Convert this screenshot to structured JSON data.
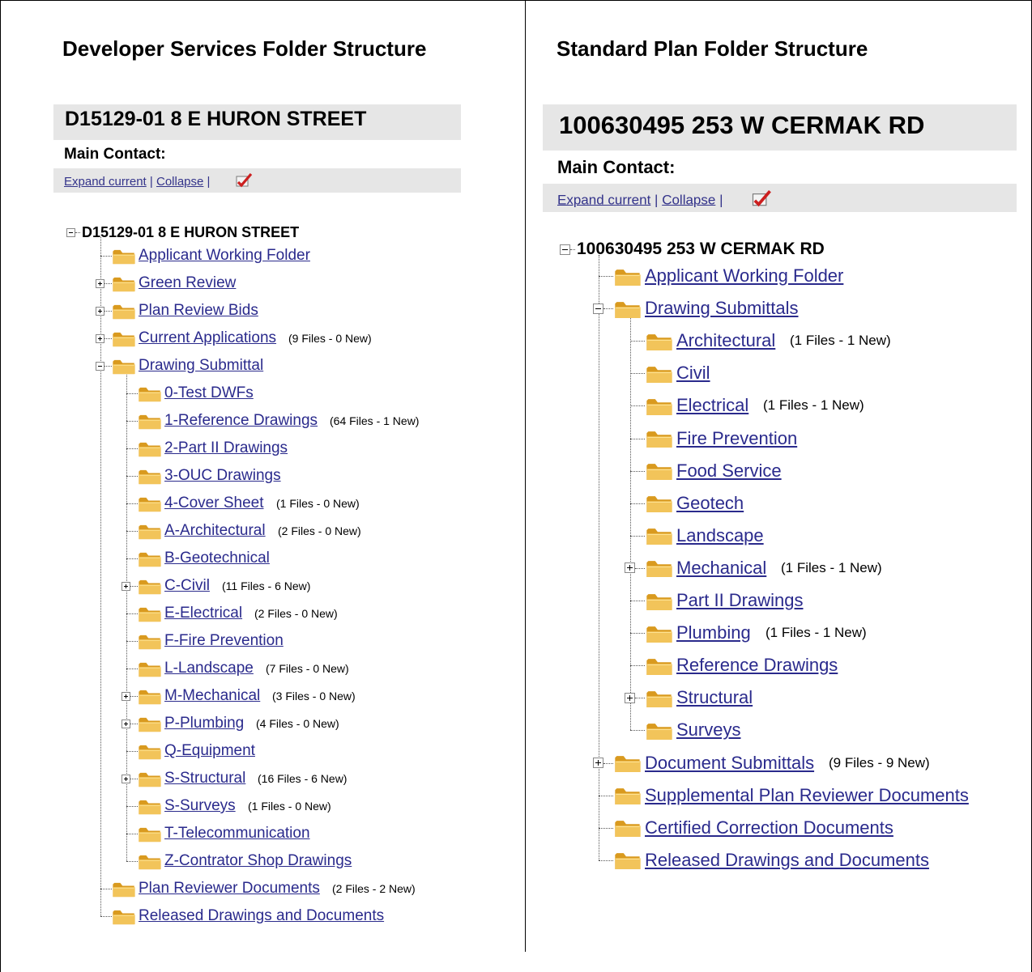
{
  "left": {
    "panel_title": "Developer Services Folder Structure",
    "project_title": "D15129-01 8 E HURON STREET",
    "main_contact": "Main Contact:",
    "toolbar": {
      "expand": "Expand current",
      "collapse": "Collapse",
      "sep": "|"
    },
    "root_label": "D15129-01 8 E HURON STREET",
    "items": [
      {
        "label": "Applicant Working Folder",
        "count": "",
        "level": 1,
        "expander": ""
      },
      {
        "label": "Green Review",
        "count": "",
        "level": 1,
        "expander": "plus"
      },
      {
        "label": "Plan Review Bids",
        "count": "",
        "level": 1,
        "expander": "plus"
      },
      {
        "label": "Current Applications",
        "count": "(9 Files - 0 New)",
        "level": 1,
        "expander": "plus"
      },
      {
        "label": "Drawing Submittal",
        "count": "",
        "level": 1,
        "expander": "minus"
      },
      {
        "label": "0-Test DWFs",
        "count": "",
        "level": 2,
        "expander": ""
      },
      {
        "label": "1-Reference Drawings",
        "count": "(64 Files - 1 New)",
        "level": 2,
        "expander": ""
      },
      {
        "label": "2-Part II Drawings",
        "count": "",
        "level": 2,
        "expander": ""
      },
      {
        "label": "3-OUC Drawings",
        "count": "",
        "level": 2,
        "expander": ""
      },
      {
        "label": "4-Cover Sheet",
        "count": "(1 Files - 0 New)",
        "level": 2,
        "expander": ""
      },
      {
        "label": "A-Architectural",
        "count": "(2 Files - 0 New)",
        "level": 2,
        "expander": ""
      },
      {
        "label": "B-Geotechnical",
        "count": "",
        "level": 2,
        "expander": ""
      },
      {
        "label": "C-Civil",
        "count": "(11 Files - 6 New)",
        "level": 2,
        "expander": "plus"
      },
      {
        "label": "E-Electrical",
        "count": "(2 Files - 0 New)",
        "level": 2,
        "expander": ""
      },
      {
        "label": "F-Fire Prevention",
        "count": "",
        "level": 2,
        "expander": ""
      },
      {
        "label": "L-Landscape",
        "count": "(7 Files - 0 New)",
        "level": 2,
        "expander": ""
      },
      {
        "label": "M-Mechanical",
        "count": "(3 Files - 0 New)",
        "level": 2,
        "expander": "plus"
      },
      {
        "label": "P-Plumbing",
        "count": "(4 Files - 0 New)",
        "level": 2,
        "expander": "plus"
      },
      {
        "label": "Q-Equipment",
        "count": "",
        "level": 2,
        "expander": ""
      },
      {
        "label": "S-Structural",
        "count": "(16 Files - 6 New)",
        "level": 2,
        "expander": "plus"
      },
      {
        "label": "S-Surveys",
        "count": "(1 Files - 0 New)",
        "level": 2,
        "expander": ""
      },
      {
        "label": "T-Telecommunication",
        "count": "",
        "level": 2,
        "expander": ""
      },
      {
        "label": "Z-Contrator Shop Drawings",
        "count": "",
        "level": 2,
        "expander": ""
      },
      {
        "label": "Plan Reviewer Documents",
        "count": "(2 Files - 2 New)",
        "level": 1,
        "expander": ""
      },
      {
        "label": "Released Drawings and Documents",
        "count": "",
        "level": 1,
        "expander": ""
      }
    ]
  },
  "right": {
    "panel_title": "Standard Plan Folder Structure",
    "project_title": "100630495 253 W CERMAK RD",
    "main_contact": "Main Contact:",
    "toolbar": {
      "expand": "Expand current",
      "collapse": "Collapse",
      "sep": "|"
    },
    "root_label": "100630495 253 W CERMAK RD",
    "items": [
      {
        "label": "Applicant Working Folder",
        "count": "",
        "level": 1,
        "expander": ""
      },
      {
        "label": "Drawing Submittals",
        "count": "",
        "level": 1,
        "expander": "minus"
      },
      {
        "label": "Architectural",
        "count": "(1 Files - 1 New)",
        "level": 2,
        "expander": ""
      },
      {
        "label": "Civil",
        "count": "",
        "level": 2,
        "expander": ""
      },
      {
        "label": "Electrical",
        "count": "(1 Files - 1 New)",
        "level": 2,
        "expander": ""
      },
      {
        "label": "Fire Prevention",
        "count": "",
        "level": 2,
        "expander": ""
      },
      {
        "label": "Food Service",
        "count": "",
        "level": 2,
        "expander": ""
      },
      {
        "label": "Geotech",
        "count": "",
        "level": 2,
        "expander": ""
      },
      {
        "label": "Landscape",
        "count": "",
        "level": 2,
        "expander": ""
      },
      {
        "label": "Mechanical",
        "count": "(1 Files - 1 New)",
        "level": 2,
        "expander": "plus"
      },
      {
        "label": "Part II Drawings",
        "count": "",
        "level": 2,
        "expander": ""
      },
      {
        "label": "Plumbing",
        "count": "(1 Files - 1 New)",
        "level": 2,
        "expander": ""
      },
      {
        "label": "Reference Drawings",
        "count": "",
        "level": 2,
        "expander": ""
      },
      {
        "label": "Structural",
        "count": "",
        "level": 2,
        "expander": "plus"
      },
      {
        "label": "Surveys",
        "count": "",
        "level": 2,
        "expander": ""
      },
      {
        "label": "Document Submittals",
        "count": "(9 Files - 9 New)",
        "level": 1,
        "expander": "plus"
      },
      {
        "label": "Supplemental Plan Reviewer Documents",
        "count": "",
        "level": 1,
        "expander": ""
      },
      {
        "label": "Certified Correction Documents",
        "count": "",
        "level": 1,
        "expander": ""
      },
      {
        "label": "Released Drawings and Documents",
        "count": "",
        "level": 1,
        "expander": ""
      }
    ]
  },
  "colors": {
    "link": "#2a2a8c",
    "bar": "#e6e6e6",
    "folder": "#f2c45a",
    "folder_dark": "#d99a1f"
  },
  "icons": {
    "toolbar": "checkmark-pencil-icon",
    "folder": "folder-icon",
    "expand": "plus-box-icon",
    "collapse": "minus-box-icon"
  }
}
